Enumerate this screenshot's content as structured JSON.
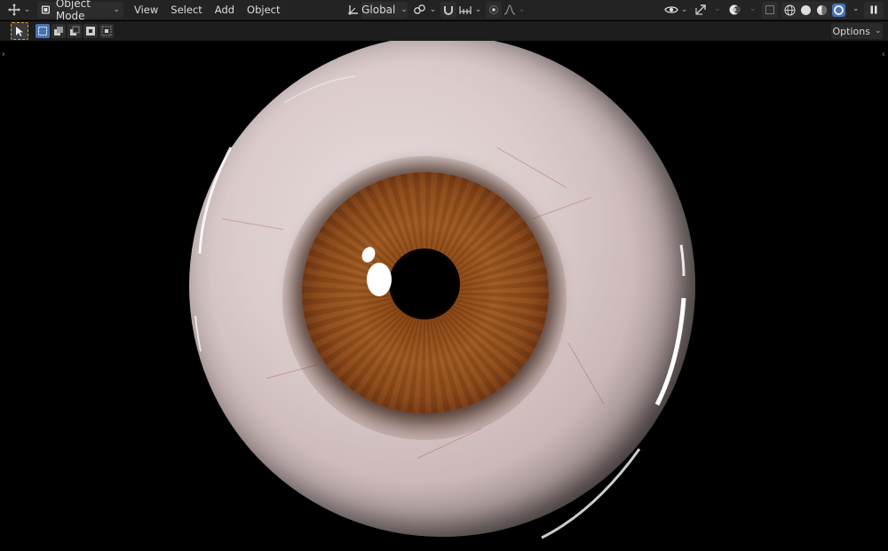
{
  "header": {
    "editor_type_icon": "move-gizmo-icon",
    "mode_label": "Object Mode",
    "menus": [
      "View",
      "Select",
      "Add",
      "Object"
    ],
    "transform_orientation": "Global",
    "pivot_icon": "link-icon",
    "snap_icon": "magnet-icon",
    "snap_target_icon": "snap-increment-icon",
    "proportional_icon": "proportional-edit-icon",
    "falloff_icon": "falloff-curve-icon",
    "visibility_icon": "eye-icon",
    "gizmo_icon": "gizmo-arrow-icon",
    "overlay_icon": "overlay-circles-icon",
    "xray_icon": "xray-icon",
    "shading_modes": [
      "wireframe",
      "solid",
      "material-preview",
      "rendered"
    ],
    "active_shading": "rendered",
    "pause_icon": "pause-icon"
  },
  "tool_settings": {
    "active_tool_icon": "select-cursor-icon",
    "select_modes": [
      "new",
      "extend",
      "subtract",
      "difference",
      "intersect"
    ],
    "active_select_mode": "new",
    "options_label": "Options"
  },
  "viewport": {
    "left_region_toggle": "›",
    "right_region_toggle": "‹",
    "subject": "eyeball-render"
  },
  "colors": {
    "header_bg": "#232323",
    "accent": "#4772b3",
    "tool_outline": "#e09a2f",
    "viewport_bg": "#000000"
  }
}
